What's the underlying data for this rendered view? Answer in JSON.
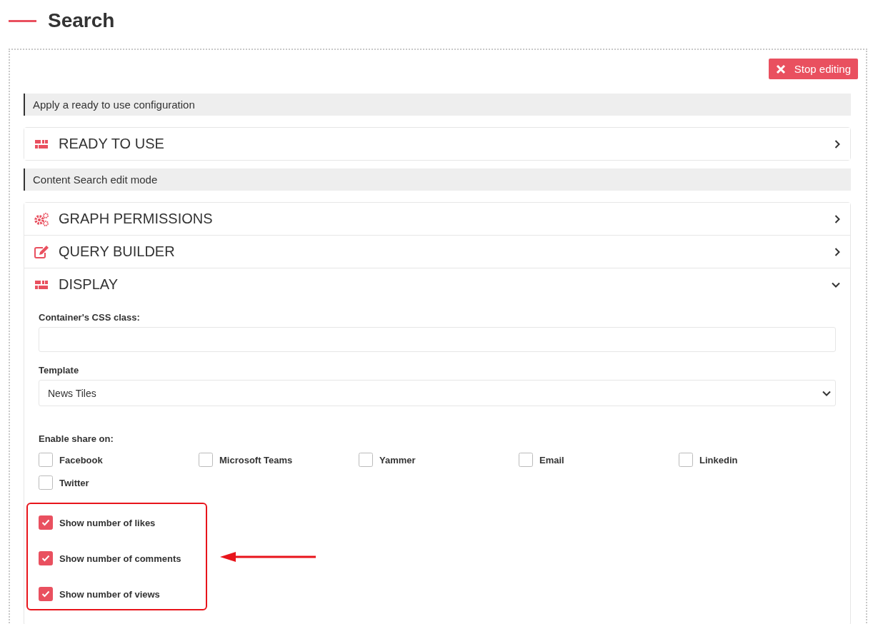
{
  "page": {
    "title": "Search"
  },
  "stop_button": {
    "label": "Stop editing"
  },
  "sections": [
    {
      "heading": "Apply a ready to use configuration",
      "panels": [
        {
          "title": "READY TO USE",
          "kind": "grid",
          "expanded": false
        }
      ]
    },
    {
      "heading": "Content Search edit mode",
      "panels": [
        {
          "title": "GRAPH PERMISSIONS",
          "kind": "gears",
          "expanded": false
        },
        {
          "title": "QUERY BUILDER",
          "kind": "edit",
          "expanded": false
        },
        {
          "title": "DISPLAY",
          "kind": "grid",
          "expanded": true,
          "form": {
            "css_class": {
              "label": "Container's CSS class:"
            },
            "template": {
              "label": "Template",
              "value": "News Tiles"
            },
            "share": {
              "label": "Enable share on:",
              "options": [
                {
                  "label": "Facebook",
                  "checked": false
                },
                {
                  "label": "Microsoft Teams",
                  "checked": false
                },
                {
                  "label": "Yammer",
                  "checked": false
                },
                {
                  "label": "Email",
                  "checked": false
                },
                {
                  "label": "Linkedin",
                  "checked": false
                },
                {
                  "label": "Twitter",
                  "checked": false
                }
              ]
            },
            "counters": [
              {
                "label": "Show number of likes",
                "checked": true
              },
              {
                "label": "Show number of comments",
                "checked": true
              },
              {
                "label": "Show number of views",
                "checked": true
              }
            ]
          }
        }
      ]
    }
  ]
}
